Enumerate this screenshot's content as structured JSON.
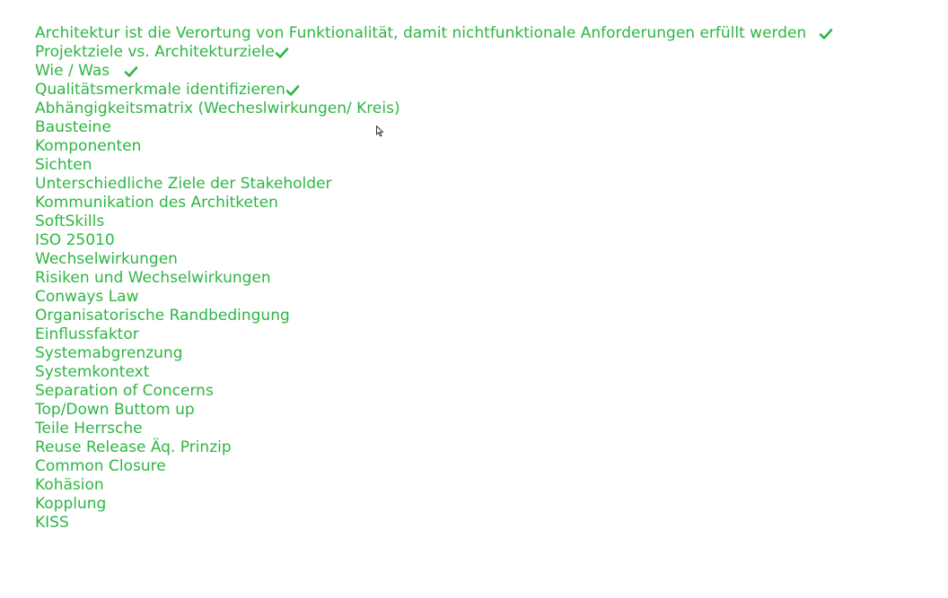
{
  "topics": [
    {
      "label": "Architektur ist die Verortung von Funktionalität, damit nichtfunktionale Anforderungen erfüllt werden",
      "checked": true
    },
    {
      "label": "Projektziele vs. Architekturziele",
      "checked": true
    },
    {
      "label": "Wie / Was",
      "checked": true
    },
    {
      "label": "Qualitätsmerkmale identifizieren",
      "checked": true
    },
    {
      "label": "Abhängigkeitsmatrix (Wecheslwirkungen/ Kreis)",
      "checked": false
    },
    {
      "label": "Bausteine",
      "checked": false
    },
    {
      "label": "Komponenten",
      "checked": false
    },
    {
      "label": "Sichten",
      "checked": false
    },
    {
      "label": "Unterschiedliche Ziele der Stakeholder",
      "checked": false
    },
    {
      "label": "Kommunikation des Architketen",
      "checked": false
    },
    {
      "label": "SoftSkills",
      "checked": false
    },
    {
      "label": "ISO 25010",
      "checked": false
    },
    {
      "label": "Wechselwirkungen",
      "checked": false
    },
    {
      "label": "Risiken und Wechselwirkungen",
      "checked": false
    },
    {
      "label": "Conways Law",
      "checked": false
    },
    {
      "label": "Organisatorische Randbedingung",
      "checked": false
    },
    {
      "label": "Einflussfaktor",
      "checked": false
    },
    {
      "label": "Systemabgrenzung",
      "checked": false
    },
    {
      "label": "Systemkontext",
      "checked": false
    },
    {
      "label": "Separation of Concerns",
      "checked": false
    },
    {
      "label": "Top/Down Buttom up",
      "checked": false
    },
    {
      "label": "Teile Herrsche",
      "checked": false
    },
    {
      "label": "Reuse Release Äq. Prinzip",
      "checked": false
    },
    {
      "label": "Common Closure",
      "checked": false
    },
    {
      "label": "Kohäsion",
      "checked": false
    },
    {
      "label": "Kopplung",
      "checked": false
    },
    {
      "label": "KISS",
      "checked": false
    }
  ],
  "colors": {
    "text": "#2db642",
    "check": "#2db642",
    "background": "#ffffff"
  },
  "icons": {
    "check": "check-icon",
    "cursor": "mouse-pointer-icon"
  }
}
